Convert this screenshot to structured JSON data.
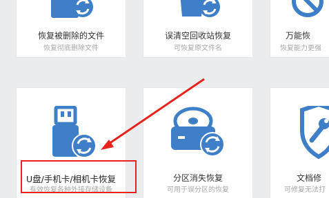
{
  "cards": [
    {
      "title": "恢复被删除的文件",
      "subtitle": "恢复彻底删除文件",
      "icon": "file-restore-icon"
    },
    {
      "title": "误清空回收站恢复",
      "subtitle": "可恢复原文件名",
      "icon": "recycle-bin-restore-icon"
    },
    {
      "title": "万能恢",
      "subtitle": "恢复能力更强",
      "icon": "universal-restore-icon"
    },
    {
      "title": "U盘/手机卡/相机卡恢复",
      "subtitle": "有效恢复各种外接存储设备",
      "icon": "usb-restore-icon"
    },
    {
      "title": "分区消失恢复",
      "subtitle": "可用于误分区的恢复",
      "icon": "partition-restore-icon"
    },
    {
      "title": "文档修",
      "subtitle": "可修复无法打",
      "icon": "document-repair-icon"
    }
  ],
  "colors": {
    "icon_blue": "#3e7fc8",
    "highlight_red": "#e8221c",
    "background": "#ebecee"
  }
}
